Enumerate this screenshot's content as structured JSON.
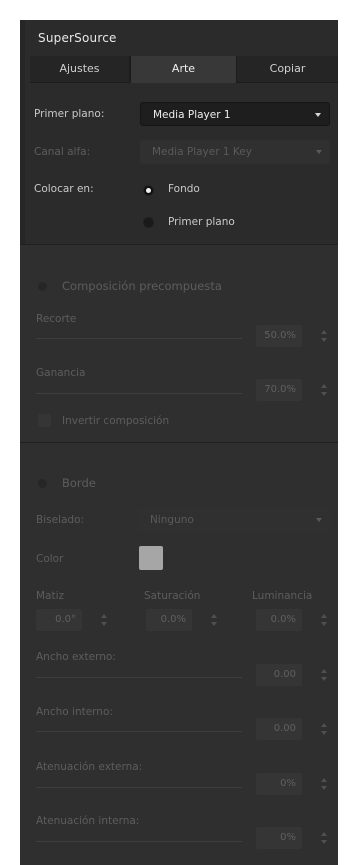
{
  "panel": {
    "title": "SuperSource"
  },
  "tabs": [
    {
      "label": "Ajustes"
    },
    {
      "label": "Arte"
    },
    {
      "label": "Copiar"
    }
  ],
  "art": {
    "foreground_label": "Primer plano:",
    "foreground_value": "Media Player 1",
    "key_label": "Canal alfa:",
    "key_value": "Media Player 1 Key",
    "place_in_label": "Colocar en:",
    "option_background": "Fondo",
    "option_foreground": "Primer plano",
    "selected_option": "Fondo"
  },
  "premultiplied": {
    "section_label": "Composición precompuesta",
    "clip_label": "Recorte",
    "clip_value": "50.0%",
    "gain_label": "Ganancia",
    "gain_value": "70.0%",
    "invert_label": "Invertir composición"
  },
  "border": {
    "section_label": "Borde",
    "bevel_label": "Biselado:",
    "bevel_value": "Ninguno",
    "color_label": "Color",
    "color_hex": "#a6a6a6",
    "hue_label": "Matiz",
    "hue_value": "0.0°",
    "saturation_label": "Saturación",
    "saturation_value": "0.0%",
    "luminance_label": "Luminancia",
    "luminance_value": "0.0%",
    "outer_width_label": "Ancho externo:",
    "outer_width_value": "0.00",
    "inner_width_label": "Ancho interno:",
    "inner_width_value": "0.00",
    "outer_soft_label": "Atenuación externa:",
    "outer_soft_value": "0%",
    "inner_soft_label": "Atenuación interna:",
    "inner_soft_value": "0%"
  }
}
